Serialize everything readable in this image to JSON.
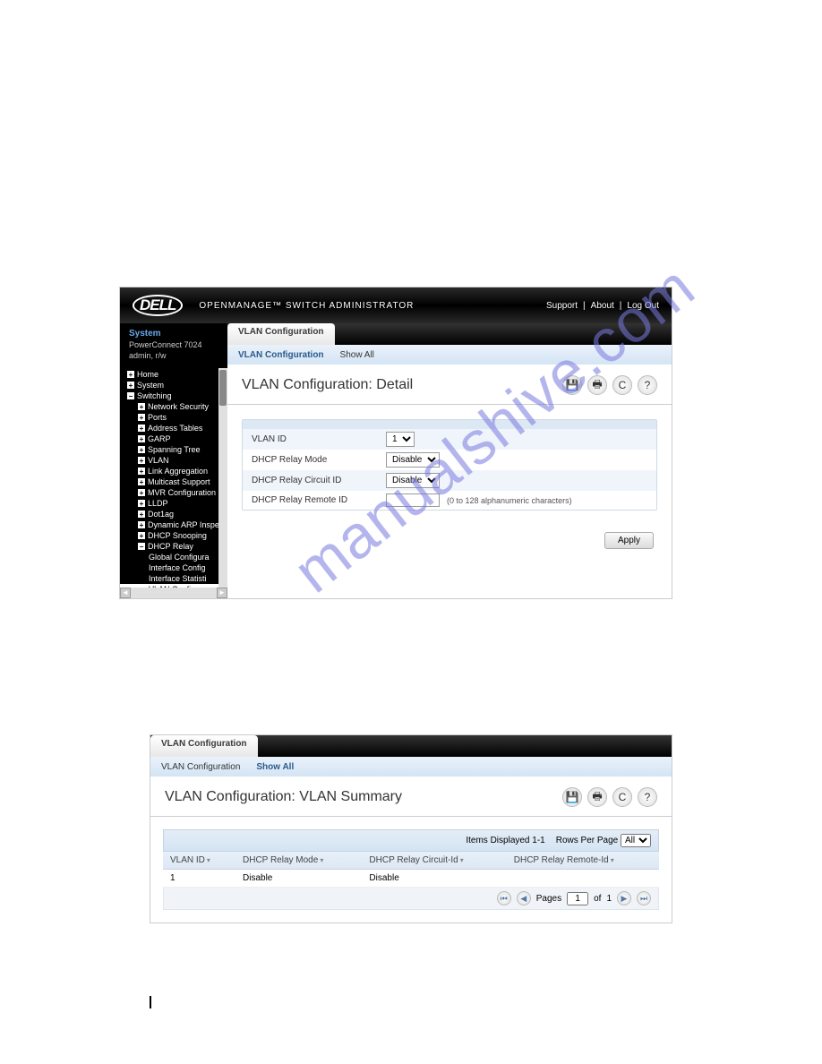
{
  "watermark": "manualshive.com",
  "topBar": {
    "logo": "DELL",
    "title": "OPENMANAGE™ SWITCH ADMINISTRATOR",
    "links": [
      "Support",
      "About",
      "Log Out"
    ]
  },
  "sidebar": {
    "systemLabel": "System",
    "device": "PowerConnect 7024",
    "user": "admin, r/w",
    "items": [
      {
        "exp": "+",
        "label": "Home",
        "level": 1
      },
      {
        "exp": "+",
        "label": "System",
        "level": 1
      },
      {
        "exp": "−",
        "label": "Switching",
        "level": 1
      },
      {
        "exp": "+",
        "label": "Network Security",
        "level": 2
      },
      {
        "exp": "+",
        "label": "Ports",
        "level": 2
      },
      {
        "exp": "+",
        "label": "Address Tables",
        "level": 2
      },
      {
        "exp": "+",
        "label": "GARP",
        "level": 2
      },
      {
        "exp": "+",
        "label": "Spanning Tree",
        "level": 2
      },
      {
        "exp": "+",
        "label": "VLAN",
        "level": 2
      },
      {
        "exp": "+",
        "label": "Link Aggregation",
        "level": 2
      },
      {
        "exp": "+",
        "label": "Multicast Support",
        "level": 2
      },
      {
        "exp": "+",
        "label": "MVR Configuration",
        "level": 2
      },
      {
        "exp": "+",
        "label": "LLDP",
        "level": 2
      },
      {
        "exp": "+",
        "label": "Dot1ag",
        "level": 2
      },
      {
        "exp": "+",
        "label": "Dynamic ARP Inspec",
        "level": 2
      },
      {
        "exp": "+",
        "label": "DHCP Snooping",
        "level": 2
      },
      {
        "exp": "−",
        "label": "DHCP Relay",
        "level": 2
      },
      {
        "exp": "",
        "label": "Global Configura",
        "level": 3
      },
      {
        "exp": "",
        "label": "Interface Config",
        "level": 3
      },
      {
        "exp": "",
        "label": "Interface Statisti",
        "level": 3
      },
      {
        "exp": "",
        "label": "VLAN Configu",
        "level": 3,
        "active": true
      }
    ]
  },
  "detail": {
    "tab": "VLAN Configuration",
    "subtabs": [
      "VLAN Configuration",
      "Show All"
    ],
    "activeSubtab": 0,
    "title": "VLAN Configuration: Detail",
    "fields": {
      "vlanId": {
        "label": "VLAN ID",
        "value": "1"
      },
      "relayMode": {
        "label": "DHCP Relay Mode",
        "value": "Disable"
      },
      "circuitId": {
        "label": "DHCP Relay Circuit ID",
        "value": "Disable"
      },
      "remoteId": {
        "label": "DHCP Relay Remote ID",
        "value": "",
        "hint": "(0 to 128 alphanumeric characters)"
      }
    },
    "applyLabel": "Apply"
  },
  "summary": {
    "tab": "VLAN Configuration",
    "subtabs": [
      "VLAN Configuration",
      "Show All"
    ],
    "activeSubtab": 1,
    "title": "VLAN Configuration: VLAN Summary",
    "itemsDisplayed": "Items Displayed 1-1",
    "rowsPerPageLabel": "Rows Per Page",
    "rowsPerPageValue": "All",
    "columns": [
      "VLAN ID",
      "DHCP Relay Mode",
      "DHCP Relay Circuit-Id",
      "DHCP Relay Remote-Id"
    ],
    "rows": [
      {
        "vlanId": "1",
        "relayMode": "Disable",
        "circuitId": "Disable",
        "remoteId": ""
      }
    ],
    "pager": {
      "pagesLabel": "Pages",
      "page": "1",
      "ofLabel": "of",
      "total": "1"
    }
  },
  "icons": {
    "save": "💾",
    "print": "🖶",
    "refresh": "C",
    "help": "?",
    "first": "⏮",
    "prev": "◀",
    "next": "▶",
    "last": "⏭"
  }
}
